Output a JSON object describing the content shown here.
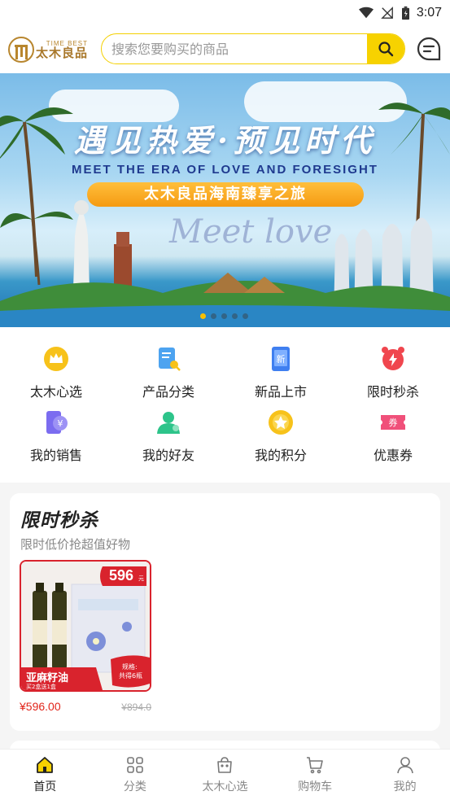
{
  "status_bar": {
    "time": "3:07"
  },
  "header": {
    "logo_en": "TIME BEST",
    "logo_cn": "太木良品",
    "search_placeholder": "搜索您要购买的商品"
  },
  "banner": {
    "title": "遇见热爱·预见时代",
    "subtitle": "MEET THE ERA OF LOVE AND FORESIGHT",
    "pill": "太木良品海南臻享之旅",
    "script_text": "Meet love",
    "dot_count": 5,
    "active_dot": 0
  },
  "grid": {
    "items": [
      {
        "label": "太木心选",
        "icon": "crown-icon",
        "color": "#f7c21a"
      },
      {
        "label": "产品分类",
        "icon": "category-icon",
        "color": "#4da3f0"
      },
      {
        "label": "新品上市",
        "icon": "new-icon",
        "color": "#3f7ff0",
        "badge": "新"
      },
      {
        "label": "限时秒杀",
        "icon": "alarm-icon",
        "color": "#f0464e"
      },
      {
        "label": "我的销售",
        "icon": "sales-icon",
        "color": "#7b6cf0",
        "badge": "¥"
      },
      {
        "label": "我的好友",
        "icon": "friends-icon",
        "color": "#2dc48a"
      },
      {
        "label": "我的积分",
        "icon": "points-icon",
        "color": "#f7c21a"
      },
      {
        "label": "优惠券",
        "icon": "coupon-icon",
        "color": "#f0507a",
        "badge": "券"
      }
    ]
  },
  "flash_sale": {
    "title": "限时秒杀",
    "subtitle": "限时低价抢超值好物",
    "products": [
      {
        "name": "亚麻籽油",
        "promo": "买2盒送1盒",
        "badge_price": "596",
        "badge_unit": "元",
        "spec_line1": "规格:",
        "spec_line2": "共得6瓶",
        "price": "¥596.00",
        "original_price": "¥894.0"
      }
    ]
  },
  "tabbar": {
    "items": [
      {
        "label": "首页",
        "icon": "home-icon",
        "active": true
      },
      {
        "label": "分类",
        "icon": "grid-icon",
        "active": false
      },
      {
        "label": "太木心选",
        "icon": "bag-icon",
        "active": false
      },
      {
        "label": "购物车",
        "icon": "cart-icon",
        "active": false
      },
      {
        "label": "我的",
        "icon": "user-icon",
        "active": false
      }
    ]
  }
}
